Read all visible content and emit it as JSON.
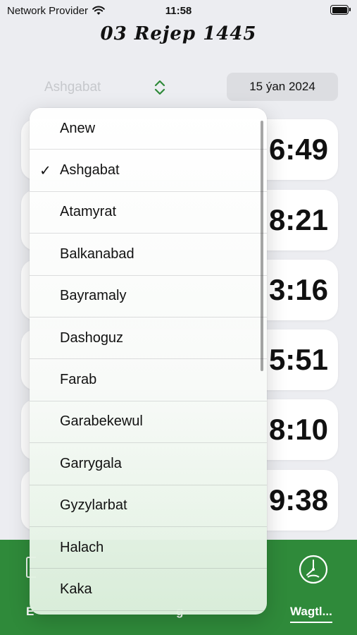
{
  "status_bar": {
    "carrier": "Network Provider",
    "time": "11:58",
    "icons": [
      "wifi-icon",
      "battery-icon"
    ]
  },
  "header": {
    "hijri_date": "03 Rejep 1445"
  },
  "city_picker": {
    "selected": "Ashgabat"
  },
  "date_picker": {
    "value": "15 ýan 2024"
  },
  "prayer_times": [
    "6:49",
    "8:21",
    "3:16",
    "5:51",
    "8:10",
    "9:38"
  ],
  "dropdown": {
    "items": [
      {
        "label": "Anew",
        "checked": false
      },
      {
        "label": "Ashgabat",
        "checked": true
      },
      {
        "label": "Atamyrat",
        "checked": false
      },
      {
        "label": "Balkanabad",
        "checked": false
      },
      {
        "label": "Bayramaly",
        "checked": false
      },
      {
        "label": "Dashoguz",
        "checked": false
      },
      {
        "label": "Farab",
        "checked": false
      },
      {
        "label": "Garabekewul",
        "checked": false
      },
      {
        "label": "Garrygala",
        "checked": false
      },
      {
        "label": "Gyzylarbat",
        "checked": false
      },
      {
        "label": "Halach",
        "checked": false
      },
      {
        "label": "Kaka",
        "checked": false
      }
    ],
    "checkmark": "✓"
  },
  "tab_bar": {
    "background": "#2f8a3a",
    "tabs": [
      {
        "label": "E",
        "icon": "book-icon"
      },
      {
        "label": "g",
        "icon": ""
      },
      {
        "label": "Wagtl...",
        "icon": "clock-icon",
        "active": true
      }
    ]
  }
}
